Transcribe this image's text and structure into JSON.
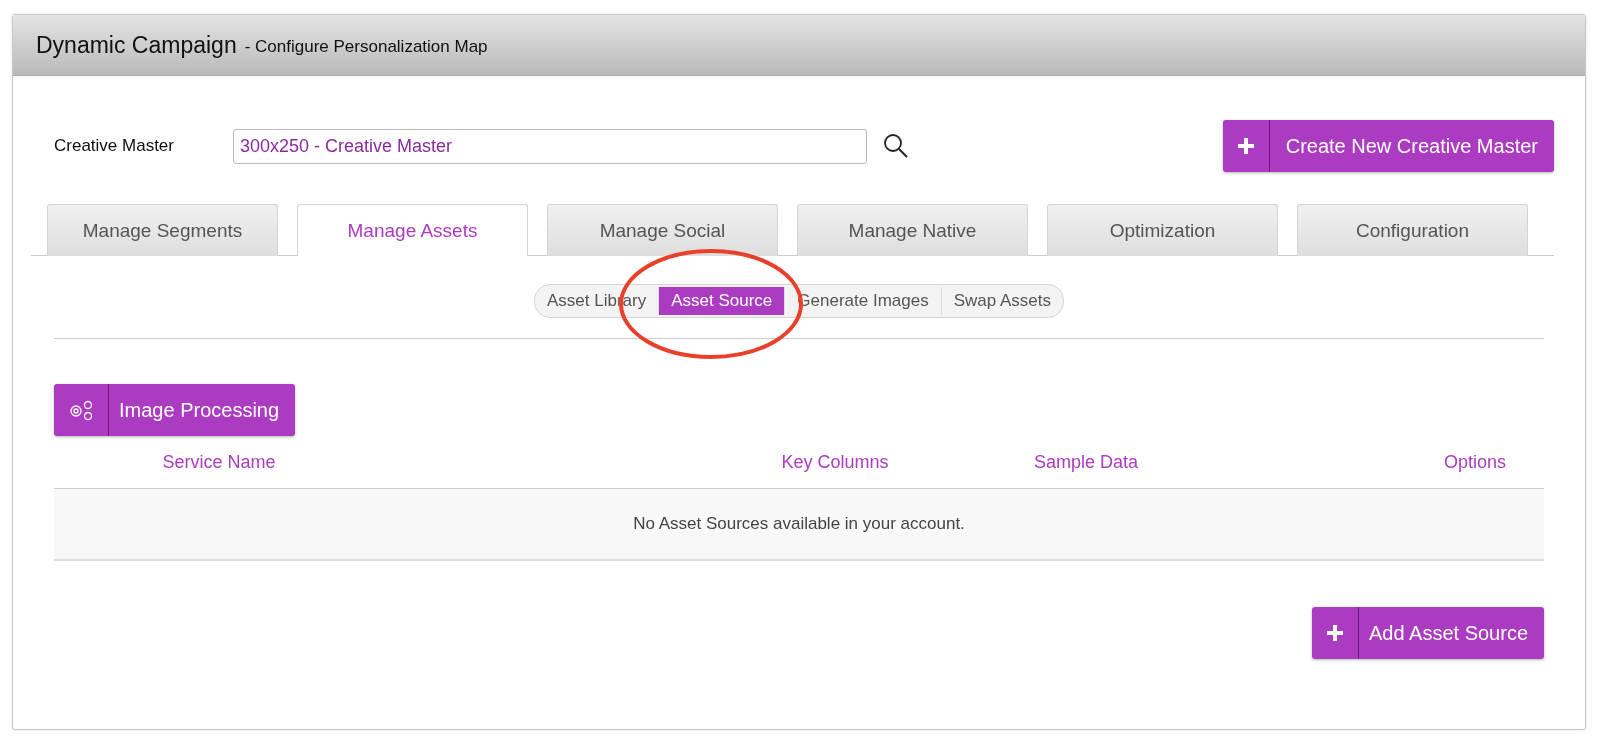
{
  "header": {
    "title": "Dynamic Campaign",
    "subtitle": "- Configure Personalization Map"
  },
  "creative_master": {
    "label": "Creative Master",
    "value": "300x250 - Creative Master"
  },
  "create_button": "Create New Creative Master",
  "tabs": [
    {
      "label": "Manage Segments",
      "selected": false
    },
    {
      "label": "Manage Assets",
      "selected": true
    },
    {
      "label": "Manage Social",
      "selected": false
    },
    {
      "label": "Manage Native",
      "selected": false
    },
    {
      "label": "Optimization",
      "selected": false
    },
    {
      "label": "Configuration",
      "selected": false
    }
  ],
  "subtabs": [
    {
      "label": "Asset Library",
      "selected": false
    },
    {
      "label": "Asset Source",
      "selected": true
    },
    {
      "label": "Generate Images",
      "selected": false
    },
    {
      "label": "Swap Assets",
      "selected": false
    }
  ],
  "image_processing_button": "Image Processing",
  "table": {
    "columns": [
      "Service Name",
      "Key Columns",
      "Sample Data",
      "Options"
    ],
    "empty_message": "No Asset Sources available in your account."
  },
  "add_button": "Add Asset Source"
}
